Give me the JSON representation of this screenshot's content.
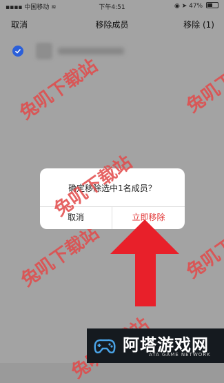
{
  "status_bar": {
    "carrier": "中国移动",
    "time": "下午4:51",
    "battery": "47%"
  },
  "nav": {
    "cancel_label": "取消",
    "title": "移除成员",
    "remove_label": "移除 (1)"
  },
  "dialog": {
    "message": "确定移除选中1名成员？",
    "cancel_label": "取消",
    "confirm_label": "立即移除"
  },
  "watermark": "兔叽下载站",
  "banner": {
    "brand": "阿塔游戏网",
    "subtitle": "ATA GAME NETWORK"
  },
  "colors": {
    "accent_blue": "#2b5fd9",
    "confirm_red": "#e23a3a",
    "arrow_red": "#e8202a",
    "overlay_gray": "#a3a3a3"
  }
}
